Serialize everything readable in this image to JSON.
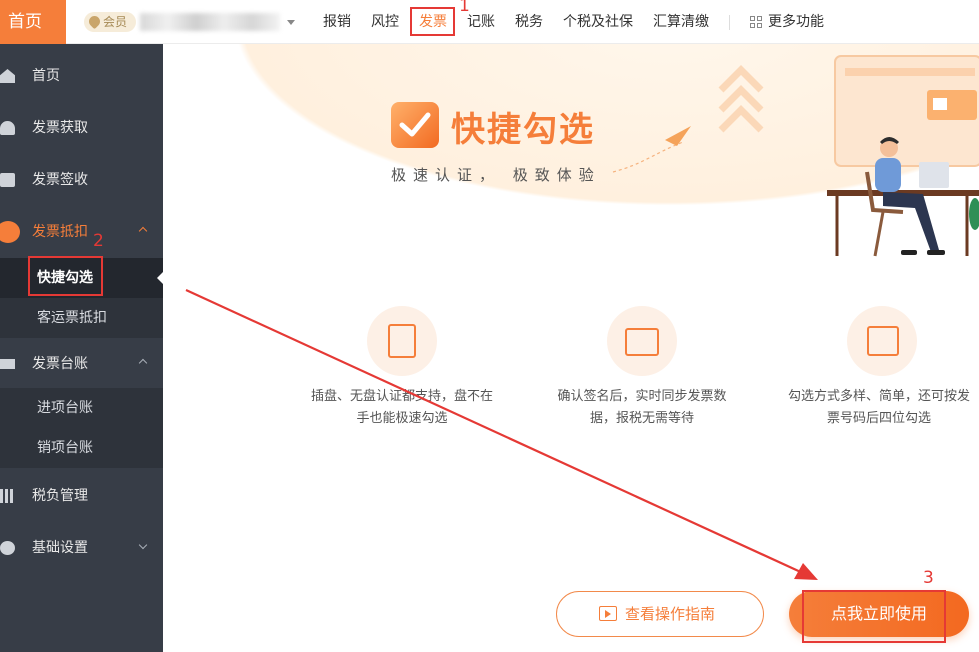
{
  "topbar": {
    "home_label": "首页",
    "member_label": "会员",
    "nav": [
      "报销",
      "风控",
      "发票",
      "记账",
      "税务",
      "个税及社保",
      "汇算清缴"
    ],
    "active_nav": "发票",
    "more_label": "更多功能"
  },
  "sidebar": {
    "items": [
      {
        "label": "首页",
        "icon": "home-icon"
      },
      {
        "label": "发票获取",
        "icon": "cloud-download-icon"
      },
      {
        "label": "发票签收",
        "icon": "ticket-icon"
      },
      {
        "label": "发票抵扣",
        "icon": "deduction-icon",
        "open": true
      },
      {
        "label": "发票台账",
        "icon": "ledger-icon",
        "open": true
      },
      {
        "label": "税负管理",
        "icon": "bar-chart-icon"
      },
      {
        "label": "基础设置",
        "icon": "gear-icon"
      }
    ],
    "deduction_sub": [
      "快捷勾选",
      "客运票抵扣"
    ],
    "ledger_sub": [
      "进项台账",
      "销项台账"
    ],
    "active_sub": "快捷勾选"
  },
  "banner": {
    "title": "快捷勾选",
    "subtitle": "极速认证， 极致体验"
  },
  "features": [
    {
      "text_line1": "插盘、无盘认证都支持，盘不在",
      "text_line2": "手也能极速勾选"
    },
    {
      "text_line1": "确认签名后，实时同步发票数",
      "text_line2": "据，报税无需等待"
    },
    {
      "text_line1": "勾选方式多样、简单，还可按发",
      "text_line2": "票号码后四位勾选"
    }
  ],
  "buttons": {
    "guide_label": "查看操作指南",
    "use_label": "点我立即使用"
  },
  "annotations": [
    "1",
    "2",
    "3"
  ],
  "colors": {
    "accent": "#f57e3a",
    "sidebar_bg": "#373d47",
    "annotation_red": "#e53935"
  }
}
